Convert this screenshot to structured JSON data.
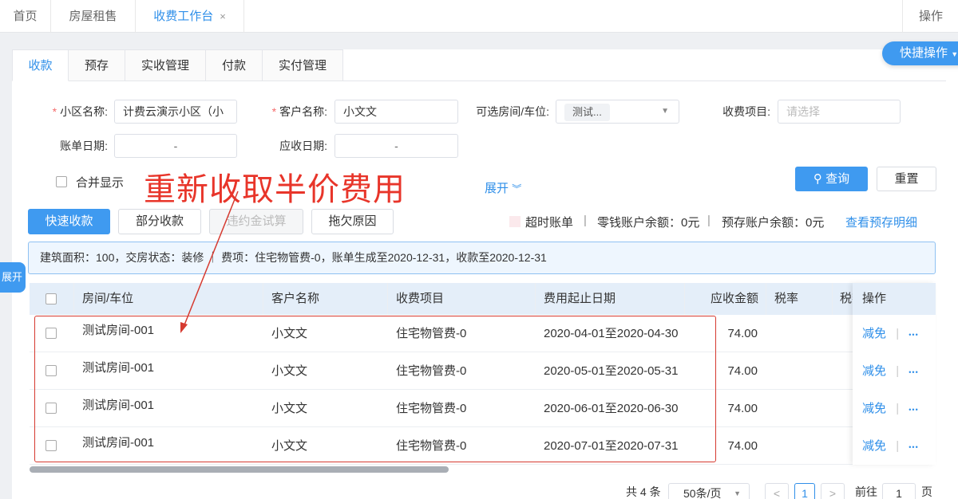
{
  "topnav": {
    "tabs": [
      {
        "label": "首页"
      },
      {
        "label": "房屋租售"
      },
      {
        "label": "收费工作台"
      }
    ],
    "close_icon": "×",
    "ops_label": "操作"
  },
  "quick_actions": {
    "label": "快捷操作"
  },
  "subtabs": [
    "收款",
    "预存",
    "实收管理",
    "付款",
    "实付管理"
  ],
  "filters": {
    "community_label": "小区名称:",
    "community_value": "计费云演示小区（小",
    "customer_label": "客户名称:",
    "customer_value": "小文文",
    "room_label": "可选房间/车位:",
    "room_value": "测试...",
    "item_label": "收费项目:",
    "item_placeholder": "请选择",
    "bill_date_label": "账单日期:",
    "due_date_label": "应收日期:",
    "range_sep": "-",
    "merge_label": "合并显示",
    "expand_label": "展开",
    "query_label": "查询",
    "reset_label": "重置"
  },
  "annotation": "重新收取半价费用",
  "actions": {
    "quick_collect": "快速收款",
    "partial_collect": "部分收款",
    "penalty_calc": "违约金试算",
    "arrears_reason": "拖欠原因"
  },
  "stats": {
    "overdue_label": "超时账单",
    "change_balance": "零钱账户余额：0元",
    "prestore_balance": "预存账户余额：0元",
    "prestore_detail": "查看预存明细",
    "sep": "|"
  },
  "infobar": "建筑面积：100，交房状态：装修 ｜ 费项：住宅物管费-0，账单生成至2020-12-31，收款至2020-12-31",
  "side_tab": "展开",
  "table": {
    "headers": {
      "room": "房间/车位",
      "customer": "客户名称",
      "item": "收费项目",
      "period": "费用起止日期",
      "amount": "应收金额",
      "tax_rate": "税率",
      "tax": "税额",
      "ops": "操作"
    },
    "rows": [
      {
        "room": "测试房间-001",
        "customer": "小文文",
        "item": "住宅物管费-0",
        "period": "2020-04-01至2020-04-30",
        "amount": "74.00"
      },
      {
        "room": "测试房间-001",
        "customer": "小文文",
        "item": "住宅物管费-0",
        "period": "2020-05-01至2020-05-31",
        "amount": "74.00"
      },
      {
        "room": "测试房间-001",
        "customer": "小文文",
        "item": "住宅物管费-0",
        "period": "2020-06-01至2020-06-30",
        "amount": "74.00"
      },
      {
        "room": "测试房间-001",
        "customer": "小文文",
        "item": "住宅物管费-0",
        "period": "2020-07-01至2020-07-31",
        "amount": "74.00"
      }
    ],
    "row_action": "减免",
    "more_icon": "•••"
  },
  "pager": {
    "total": "共 4 条",
    "page_size": "50条/页",
    "current": "1",
    "goto_label": "前往",
    "goto_value": "1",
    "page_unit": "页"
  }
}
